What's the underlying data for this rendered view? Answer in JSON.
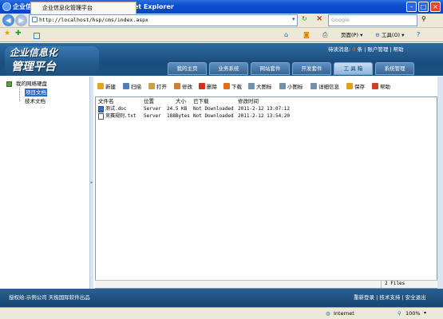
{
  "window": {
    "title": "企业信息化管理平台 - Windows Internet Explorer",
    "minimize": "–",
    "maximize": "□",
    "close": "×"
  },
  "browser": {
    "address": "http://localhost/hsp/cms/index.aspx",
    "search_placeholder": "Google",
    "tab_title": "企业信息化管理平台",
    "tools": [
      "页面(P)",
      "工具(O)"
    ],
    "status_zone": "Internet",
    "zoom": "100%"
  },
  "app": {
    "logo_line1": "企业信息化",
    "logo_line2": "管理平台",
    "user_bar": {
      "prefix": "待读消息:",
      "count": "0",
      "suffix": "条",
      "links": [
        "账户管理",
        "帮助"
      ]
    },
    "nav_tabs": [
      {
        "label": "我的主页",
        "active": false
      },
      {
        "label": "业务系统",
        "active": false
      },
      {
        "label": "网站套件",
        "active": false
      },
      {
        "label": "开发套件",
        "active": false
      },
      {
        "label": "工 具 箱",
        "active": true
      },
      {
        "label": "系统管理",
        "active": false
      }
    ]
  },
  "tree": {
    "root": "我的网络硬盘",
    "children": [
      {
        "label": "项目文档",
        "selected": true
      },
      {
        "label": "技术文档",
        "selected": false
      }
    ]
  },
  "toolbar": [
    {
      "label": "新建",
      "icon": "new-icon",
      "color": "#e8a020"
    },
    {
      "label": "扫描",
      "icon": "scan-icon",
      "color": "#4a7fc0"
    },
    {
      "label": "打开",
      "icon": "open-icon",
      "color": "#d0a040"
    },
    {
      "label": "修改",
      "icon": "edit-icon",
      "color": "#d08030"
    },
    {
      "label": "删除",
      "icon": "delete-icon",
      "color": "#d03020"
    },
    {
      "label": "下载",
      "icon": "download-icon",
      "color": "#e07020"
    },
    {
      "label": "大图标",
      "icon": "large-icons-icon",
      "color": "#7090b0"
    },
    {
      "label": "小图标",
      "icon": "small-icons-icon",
      "color": "#7090b0"
    },
    {
      "label": "详细信息",
      "icon": "details-icon",
      "color": "#7090b0"
    },
    {
      "label": "保存",
      "icon": "save-icon",
      "color": "#e0a020"
    },
    {
      "label": "帮助",
      "icon": "help-icon",
      "color": "#d04020"
    }
  ],
  "files": {
    "columns": [
      "文件名",
      "位置",
      "大小",
      "已下载",
      "修改时间"
    ],
    "rows": [
      {
        "name": "测试.doc",
        "location": "Server",
        "size": "24.5 KB",
        "downloaded": "Not Downloaded",
        "modified": "2011-2-12 13:07:12"
      },
      {
        "name": "竞赛规则.txt",
        "location": "Server",
        "size": "188Bytes",
        "downloaded": "Not Downloaded",
        "modified": "2011-2-12 13:54:20"
      }
    ],
    "count": "2 Files"
  },
  "footer": {
    "left": "授权给:示例公司   天极国际软件出品",
    "right": [
      "重新登录",
      "技术支持",
      "安全退出"
    ]
  }
}
